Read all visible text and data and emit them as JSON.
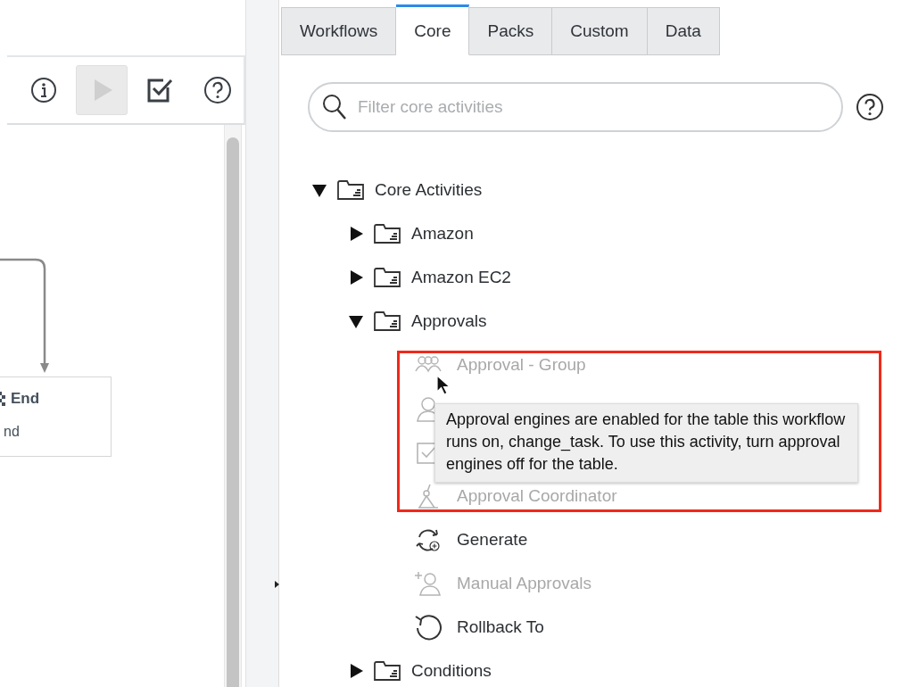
{
  "toolbar": {
    "buttons": [
      {
        "kind": "info",
        "disabled": false
      },
      {
        "kind": "run",
        "disabled": true
      },
      {
        "kind": "check",
        "disabled": false
      },
      {
        "kind": "help",
        "disabled": false
      }
    ]
  },
  "canvas": {
    "node": {
      "title": "End",
      "subtitle": "nd"
    }
  },
  "tabs": [
    {
      "label": "Workflows",
      "selected": false
    },
    {
      "label": "Core",
      "selected": true
    },
    {
      "label": "Packs",
      "selected": false
    },
    {
      "label": "Custom",
      "selected": false
    },
    {
      "label": "Data",
      "selected": false
    }
  ],
  "search": {
    "placeholder": "Filter core activities"
  },
  "tree": [
    {
      "kind": "folder",
      "label": "Core Activities",
      "expanded": true,
      "children": [
        {
          "kind": "folder",
          "label": "Amazon",
          "expanded": false
        },
        {
          "kind": "folder",
          "label": "Amazon EC2",
          "expanded": false
        },
        {
          "kind": "folder",
          "label": "Approvals",
          "expanded": true,
          "children": [
            {
              "kind": "group",
              "label": "Approval - Group",
              "disabled": true
            },
            {
              "kind": "user",
              "disabled": true
            },
            {
              "kind": "checkbox",
              "disabled": true
            },
            {
              "kind": "coordinator",
              "label": "Approval Coordinator",
              "disabled": true
            },
            {
              "kind": "generate",
              "label": "Generate",
              "disabled": false
            },
            {
              "kind": "manual",
              "label": "Manual Approvals",
              "disabled": true
            },
            {
              "kind": "rollback",
              "label": "Rollback To",
              "disabled": false
            }
          ]
        },
        {
          "kind": "folder",
          "label": "Conditions",
          "expanded": false
        }
      ]
    }
  ],
  "tooltip": {
    "text": "Approval engines are enabled for the table this workflow runs on, change_task. To use this activity, turn approval engines off for the table."
  }
}
